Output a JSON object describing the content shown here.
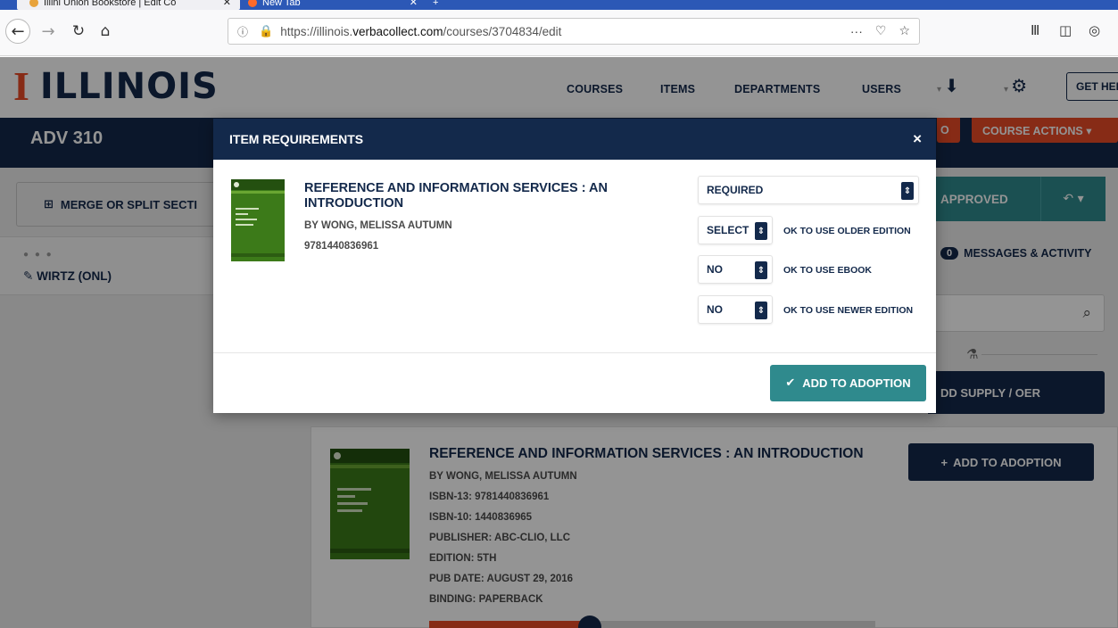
{
  "browser": {
    "tabs": [
      {
        "title": "Illini Union Bookstore | Edit Co",
        "active": true,
        "icon": "bookstore-favicon-icon"
      },
      {
        "title": "New Tab",
        "active": false,
        "icon": "firefox-icon"
      }
    ],
    "new_tab_symbol": "+",
    "url": {
      "protocol": "https://illinois.",
      "host": "verbacollect.com",
      "path": "/courses/3704834/edit"
    },
    "url_actions": [
      "···",
      "♡",
      "☆"
    ],
    "library_icon": "library-icon",
    "sidebar_icon": "sidebar-toggle-icon",
    "account_icon": "account-icon"
  },
  "site": {
    "logo_mark": "I",
    "logo_text": "ILLINOIS",
    "nav": [
      "COURSES",
      "ITEMS",
      "DEPARTMENTS",
      "USERS"
    ],
    "get_help": "GET HEL"
  },
  "course": {
    "code": "ADV 310",
    "actions_button": "COURSE ACTIONS ▾",
    "left_orange_button": "O"
  },
  "sidebar": {
    "merge_button": "MERGE OR SPLIT SECTI",
    "section_dots": "● ● ●",
    "section_name": "WIRTZ (ONL)"
  },
  "status": {
    "approved": "APPROVED",
    "messages_count": "0",
    "messages_label": "MESSAGES & ACTIVITY",
    "supply_button": "DD SUPPLY / OER"
  },
  "result": {
    "title": "REFERENCE AND INFORMATION SERVICES : AN INTRODUCTION",
    "author": "BY WONG, MELISSA AUTUMN",
    "isbn13": "ISBN-13: 9781440836961",
    "isbn10": "ISBN-10: 1440836965",
    "publisher": "PUBLISHER: ABC-CLIO, LLC",
    "edition": "EDITION: 5TH",
    "pub_date": "PUB DATE: AUGUST 29, 2016",
    "binding": "BINDING: PAPERBACK",
    "add_button": "ADD TO ADOPTION",
    "progress": 0.36
  },
  "modal": {
    "title": "ITEM REQUIREMENTS",
    "close": "×",
    "item_title": "REFERENCE AND INFORMATION SERVICES : AN INTRODUCTION",
    "item_author": "BY WONG, MELISSA AUTUMN",
    "item_isbn": "9781440836961",
    "requirement": "REQUIRED",
    "older_edition": {
      "value": "SELECT",
      "label": "OK TO USE OLDER EDITION"
    },
    "ebook": {
      "value": "NO",
      "label": "OK TO USE EBOOK"
    },
    "newer_edition": {
      "value": "NO",
      "label": "OK TO USE NEWER EDITION"
    },
    "add_button": "ADD TO ADOPTION"
  },
  "colors": {
    "illinois_orange": "#e84a27",
    "illinois_blue": "#13294b",
    "teal": "#2f8a8d"
  }
}
